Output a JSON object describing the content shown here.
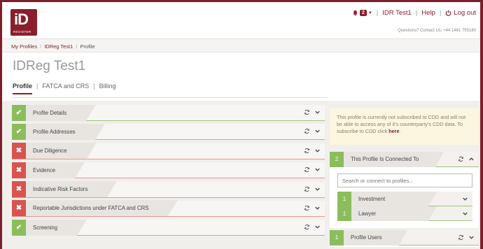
{
  "brand": {
    "logo_text": "iD",
    "logo_subtext": "REGISTER",
    "accent": "#8b1e2c",
    "ok_color": "#8bbd5c",
    "error_color": "#d9534f"
  },
  "topnav": {
    "notification_count": "2",
    "user": "IDR Test1",
    "help": "Help",
    "logout": "Log out",
    "separator": "|",
    "contact": "Questions? Contact Us: +44 1461 755180"
  },
  "breadcrumb": {
    "items": [
      "My Profiles",
      "IDReg Test1",
      "Profile"
    ],
    "separator": "/"
  },
  "page": {
    "title": "IDReg Test1"
  },
  "tabs": [
    {
      "label": "Profile",
      "active": true
    },
    {
      "label": "FATCA and CRS",
      "active": false
    },
    {
      "label": "Billing",
      "active": false
    }
  ],
  "tab_separator": "|",
  "sections": [
    {
      "label": "Profile Details",
      "status": "ok",
      "status_icon": "check-icon"
    },
    {
      "label": "Profile Addresses",
      "status": "ok",
      "status_icon": "check-icon"
    },
    {
      "label": "Due Diligence",
      "status": "bad",
      "status_icon": "cross-icon"
    },
    {
      "label": "Evidence",
      "status": "bad",
      "status_icon": "cross-icon"
    },
    {
      "label": "Indicative Risk Factors",
      "status": "bad",
      "status_icon": "cross-icon"
    },
    {
      "label": "Reportable Jurisdictions under FATCA and CRS",
      "status": "bad",
      "status_icon": "cross-icon"
    },
    {
      "label": "Screening",
      "status": "ok",
      "status_icon": "check-icon"
    }
  ],
  "notice": {
    "text": "This profile is currently not subscribed to CDD and will not be able to access any of it's counterparty's CDD data. To subscribe to CDD click ",
    "link": "here",
    "end": "."
  },
  "connected_panel": {
    "count": "2",
    "title": "This Profile Is Connected To",
    "search_placeholder": "Search or connect to profiles...",
    "items": [
      {
        "num": "1",
        "label": "Investment"
      },
      {
        "num": "1",
        "label": "Lawyer"
      }
    ]
  },
  "users_panel": {
    "count": "1",
    "title": "Profile Users"
  }
}
